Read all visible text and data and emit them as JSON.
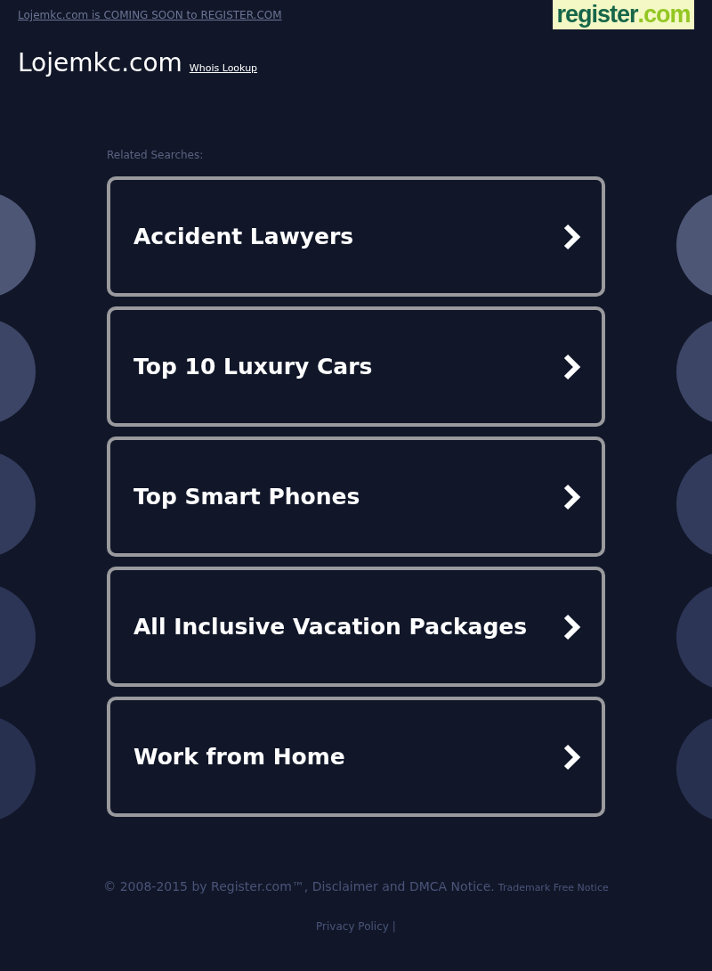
{
  "top_link": "Lojemkc.com is COMING SOON to REGISTER.COM",
  "logo": {
    "main": "register",
    "suffix": ".com"
  },
  "site_title": "Lojemkc.com",
  "whois_link": "Whois Lookup",
  "related_label": "Related Searches:",
  "searches": [
    "Accident Lawyers",
    "Top 10 Luxury Cars",
    "Top Smart Phones",
    "All Inclusive Vacation Packages",
    "Work from Home"
  ],
  "footer": {
    "copyright": "© 2008-2015 by Register.com™, Disclaimer and DMCA Notice.",
    "trademark": "Trademark Free Notice",
    "privacy": "Privacy Policy",
    "separator": "|"
  }
}
